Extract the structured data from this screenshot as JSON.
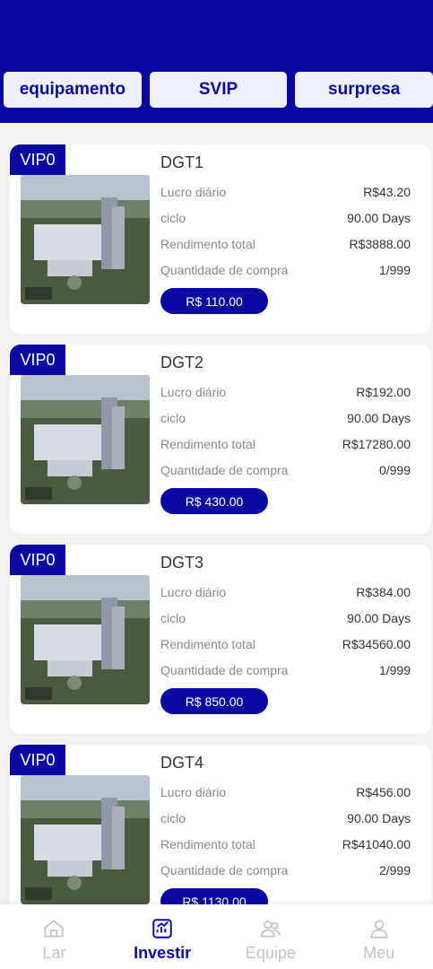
{
  "tabs": [
    "equipamento",
    "SVIP",
    "surpresa"
  ],
  "labels": {
    "daily": "Lucro diário",
    "cycle": "ciclo",
    "total": "Rendimento total",
    "qty": "Quantidade de compra"
  },
  "products": [
    {
      "vip": "VIP0",
      "name": "DGT1",
      "daily": "R$43.20",
      "cycle": "90.00 Days",
      "total": "R$3888.00",
      "qty": "1/999",
      "price": "R$ 110.00"
    },
    {
      "vip": "VIP0",
      "name": "DGT2",
      "daily": "R$192.00",
      "cycle": "90.00 Days",
      "total": "R$17280.00",
      "qty": "0/999",
      "price": "R$ 430.00"
    },
    {
      "vip": "VIP0",
      "name": "DGT3",
      "daily": "R$384.00",
      "cycle": "90.00 Days",
      "total": "R$34560.00",
      "qty": "1/999",
      "price": "R$ 850.00"
    },
    {
      "vip": "VIP0",
      "name": "DGT4",
      "daily": "R$456.00",
      "cycle": "90.00 Days",
      "total": "R$41040.00",
      "qty": "2/999",
      "price": "R$ 1130.00"
    }
  ],
  "nav": [
    {
      "label": "Lar",
      "icon": "home-icon",
      "active": false
    },
    {
      "label": "Investir",
      "icon": "chart-icon",
      "active": true
    },
    {
      "label": "Equipe",
      "icon": "team-icon",
      "active": false
    },
    {
      "label": "Meu",
      "icon": "user-icon",
      "active": false
    }
  ],
  "colors": {
    "primary": "#0a0aa0",
    "inactive": "#c3c3c3"
  }
}
